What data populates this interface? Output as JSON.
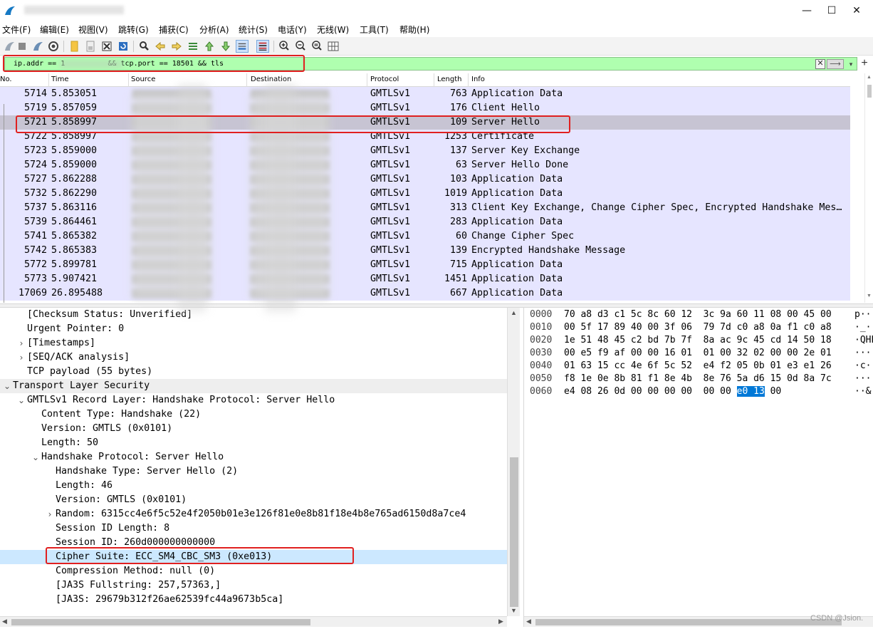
{
  "window": {
    "title": "",
    "minimize": "—",
    "maximize": "☐",
    "close": "✕"
  },
  "menu": [
    "文件(F)",
    "编辑(E)",
    "视图(V)",
    "跳转(G)",
    "捕获(C)",
    "分析(A)",
    "统计(S)",
    "电话(Y)",
    "无线(W)",
    "工具(T)",
    "帮助(H)"
  ],
  "filter": {
    "value": "ip.addr == 1          && tcp.port == 18501 && tls",
    "clear": "✕",
    "apply": "⟶",
    "dropdown": "▾",
    "add": "+"
  },
  "packet_list": {
    "columns": [
      "No.",
      "Time",
      "Source",
      "Destination",
      "Protocol",
      "Length",
      "Info"
    ],
    "rows": [
      {
        "no": "5714",
        "time": "5.853051",
        "proto": "GMTLSv1",
        "len": "763",
        "info": "Application Data"
      },
      {
        "no": "5719",
        "time": "5.857059",
        "proto": "GMTLSv1",
        "len": "176",
        "info": "Client Hello"
      },
      {
        "no": "5721",
        "time": "5.858997",
        "proto": "GMTLSv1",
        "len": "109",
        "info": "Server Hello"
      },
      {
        "no": "5722",
        "time": "5.858997",
        "proto": "GMTLSv1",
        "len": "1253",
        "info": "Certificate"
      },
      {
        "no": "5723",
        "time": "5.859000",
        "proto": "GMTLSv1",
        "len": "137",
        "info": "Server Key Exchange"
      },
      {
        "no": "5724",
        "time": "5.859000",
        "proto": "GMTLSv1",
        "len": "63",
        "info": "Server Hello Done"
      },
      {
        "no": "5727",
        "time": "5.862288",
        "proto": "GMTLSv1",
        "len": "103",
        "info": "Application Data"
      },
      {
        "no": "5732",
        "time": "5.862290",
        "proto": "GMTLSv1",
        "len": "1019",
        "info": "Application Data"
      },
      {
        "no": "5737",
        "time": "5.863116",
        "proto": "GMTLSv1",
        "len": "313",
        "info": "Client Key Exchange, Change Cipher Spec, Encrypted Handshake Mes…"
      },
      {
        "no": "5739",
        "time": "5.864461",
        "proto": "GMTLSv1",
        "len": "283",
        "info": "Application Data"
      },
      {
        "no": "5741",
        "time": "5.865382",
        "proto": "GMTLSv1",
        "len": "60",
        "info": "Change Cipher Spec"
      },
      {
        "no": "5742",
        "time": "5.865383",
        "proto": "GMTLSv1",
        "len": "139",
        "info": "Encrypted Handshake Message"
      },
      {
        "no": "5772",
        "time": "5.899781",
        "proto": "GMTLSv1",
        "len": "715",
        "info": "Application Data"
      },
      {
        "no": "5773",
        "time": "5.907421",
        "proto": "GMTLSv1",
        "len": "1451",
        "info": "Application Data"
      },
      {
        "no": "17069",
        "time": "26.895488",
        "proto": "GMTLSv1",
        "len": "667",
        "info": "Application Data"
      }
    ],
    "selected_index": 2
  },
  "details": [
    {
      "indent": 1,
      "twisty": "",
      "text": "[Checksum Status: Unverified]"
    },
    {
      "indent": 1,
      "twisty": "",
      "text": "Urgent Pointer: 0"
    },
    {
      "indent": 1,
      "twisty": ">",
      "text": "[Timestamps]"
    },
    {
      "indent": 1,
      "twisty": ">",
      "text": "[SEQ/ACK analysis]"
    },
    {
      "indent": 1,
      "twisty": "",
      "text": "TCP payload (55 bytes)"
    },
    {
      "indent": 0,
      "twisty": "v",
      "text": "Transport Layer Security",
      "section": true
    },
    {
      "indent": 1,
      "twisty": "v",
      "text": "GMTLSv1 Record Layer: Handshake Protocol: Server Hello"
    },
    {
      "indent": 2,
      "twisty": "",
      "text": "Content Type: Handshake (22)"
    },
    {
      "indent": 2,
      "twisty": "",
      "text": "Version: GMTLS (0x0101)"
    },
    {
      "indent": 2,
      "twisty": "",
      "text": "Length: 50"
    },
    {
      "indent": 2,
      "twisty": "v",
      "text": "Handshake Protocol: Server Hello"
    },
    {
      "indent": 3,
      "twisty": "",
      "text": "Handshake Type: Server Hello (2)"
    },
    {
      "indent": 3,
      "twisty": "",
      "text": "Length: 46"
    },
    {
      "indent": 3,
      "twisty": "",
      "text": "Version: GMTLS (0x0101)"
    },
    {
      "indent": 3,
      "twisty": ">",
      "text": "Random: 6315cc4e6f5c52e4f2050b01e3e126f81e0e8b81f18e4b8e765ad6150d8a7ce4"
    },
    {
      "indent": 3,
      "twisty": "",
      "text": "Session ID Length: 8"
    },
    {
      "indent": 3,
      "twisty": "",
      "text": "Session ID: 260d000000000000"
    },
    {
      "indent": 3,
      "twisty": "",
      "text": "Cipher Suite: ECC_SM4_CBC_SM3 (0xe013)",
      "selected": true
    },
    {
      "indent": 3,
      "twisty": "",
      "text": "Compression Method: null (0)"
    },
    {
      "indent": 3,
      "twisty": "",
      "text": "[JA3S Fullstring: 257,57363,]"
    },
    {
      "indent": 3,
      "twisty": "",
      "text": "[JA3S: 29679b312f26ae62539fc44a9673b5ca]"
    }
  ],
  "bytes": [
    {
      "offset": "0000",
      "hex_pre": "70 a8 d3 c1 5c 8c 60 12  3c 9a 60 11 08 00 45 00",
      "hl": "",
      "hex_post": "",
      "ascii": "p···"
    },
    {
      "offset": "0010",
      "hex_pre": "00 5f 17 89 40 00 3f 06  79 7d c0 a8 0a f1 c0 a8",
      "hl": "",
      "hex_post": "",
      "ascii": "·_··"
    },
    {
      "offset": "0020",
      "hex_pre": "1e 51 48 45 c2 bd 7b 7f  8a ac 9c 45 cd 14 50 18",
      "hl": "",
      "hex_post": "",
      "ascii": "·QHE"
    },
    {
      "offset": "0030",
      "hex_pre": "00 e5 f9 af 00 00 16 01  01 00 32 02 00 00 2e 01",
      "hl": "",
      "hex_post": "",
      "ascii": "····"
    },
    {
      "offset": "0040",
      "hex_pre": "01 63 15 cc 4e 6f 5c 52  e4 f2 05 0b 01 e3 e1 26",
      "hl": "",
      "hex_post": "",
      "ascii": "·c··"
    },
    {
      "offset": "0050",
      "hex_pre": "f8 1e 0e 8b 81 f1 8e 4b  8e 76 5a d6 15 0d 8a 7c",
      "hl": "",
      "hex_post": "",
      "ascii": "····"
    },
    {
      "offset": "0060",
      "hex_pre": "e4 08 26 0d 00 00 00 00  00 00 ",
      "hl": "e0 13",
      "hex_post": " 00",
      "ascii": "··&·"
    }
  ],
  "watermark": "CSDN @Jsion."
}
